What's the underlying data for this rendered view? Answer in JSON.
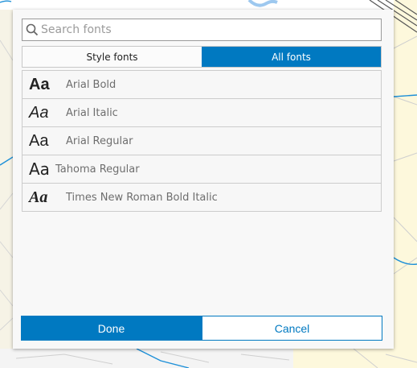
{
  "colors": {
    "accent": "#0079c1",
    "dialog_bg": "#f8f8f8",
    "map_bg": "#f6f3e6"
  },
  "search": {
    "placeholder": "Search fonts",
    "value": "",
    "icon": "search-icon"
  },
  "tabs": [
    {
      "label": "Style fonts",
      "selected": false
    },
    {
      "label": "All fonts",
      "selected": true
    }
  ],
  "fonts": [
    {
      "sample": "Aa",
      "name": "Arial Bold"
    },
    {
      "sample": "Aa",
      "name": "Arial Italic"
    },
    {
      "sample": "Aa",
      "name": "Arial Regular"
    },
    {
      "sample": "Aa",
      "name": "Tahoma Regular"
    },
    {
      "sample": "Aa",
      "name": "Times New Roman Bold Italic"
    }
  ],
  "buttons": {
    "done": "Done",
    "cancel": "Cancel"
  }
}
